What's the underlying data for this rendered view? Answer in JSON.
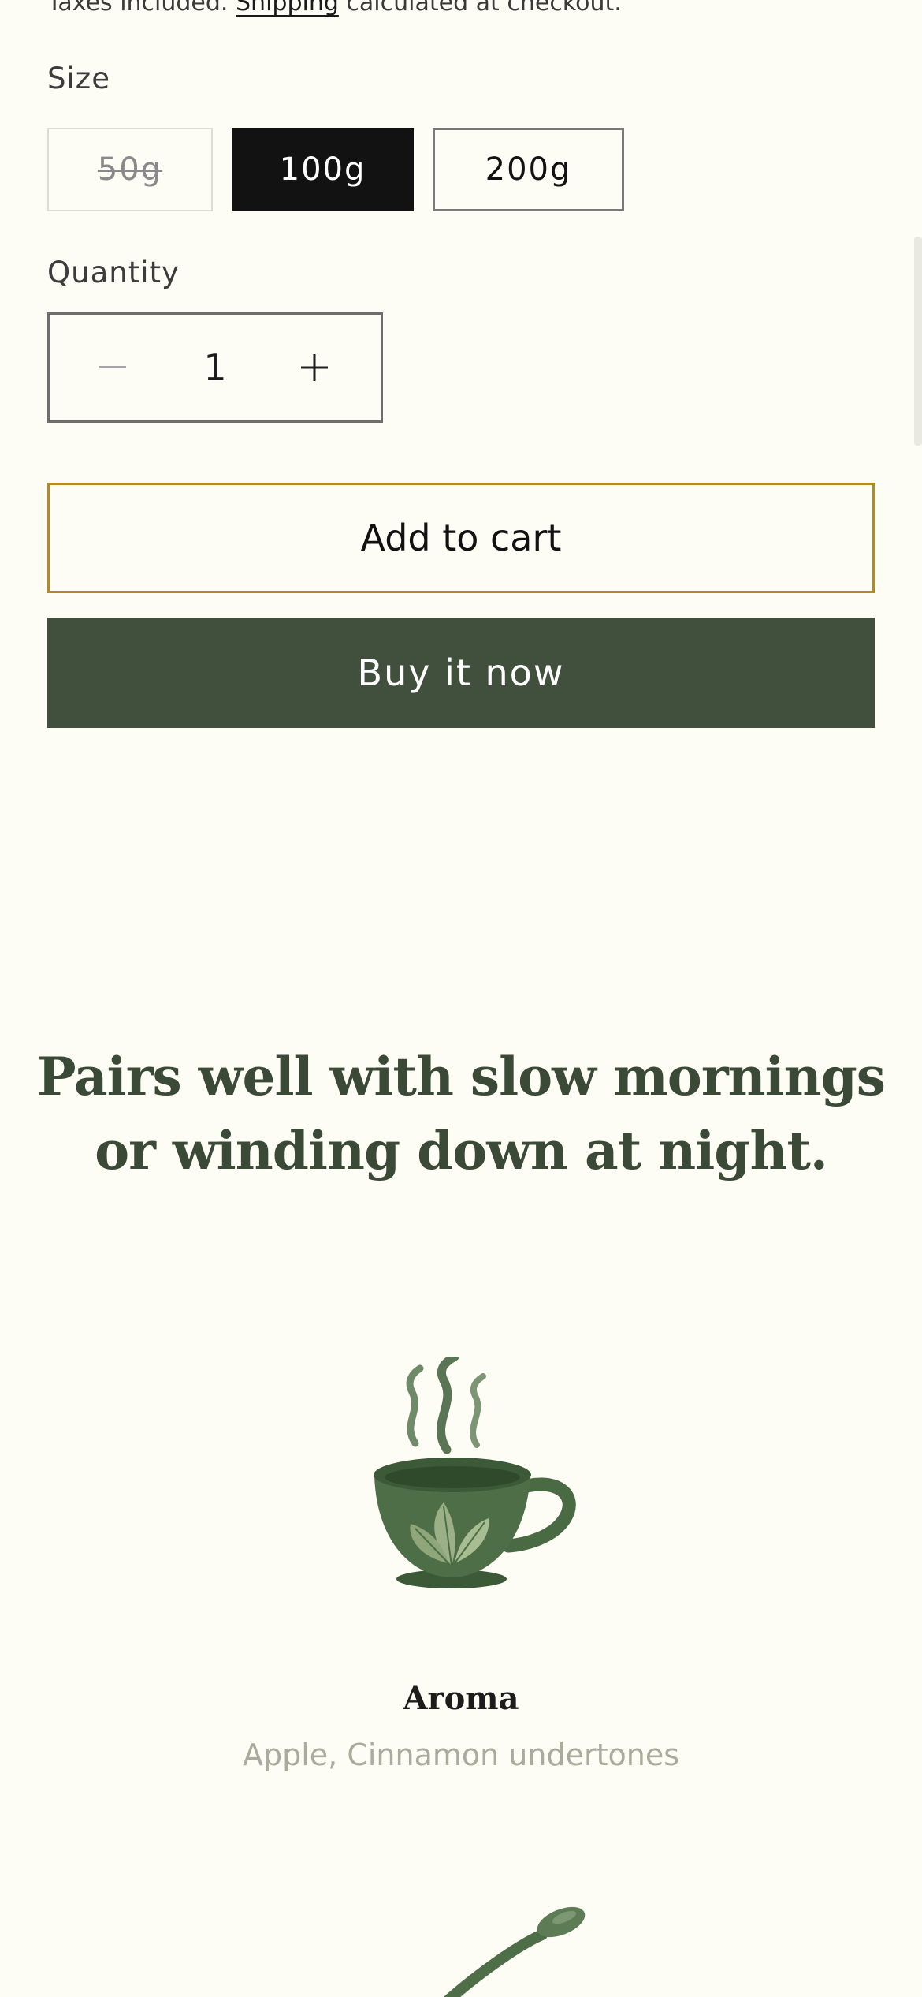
{
  "purchase": {
    "tax_note_prefix": "Taxes included. ",
    "tax_note_link": "Shipping",
    "tax_note_suffix": " calculated at checkout.",
    "size_label": "Size",
    "sizes": [
      {
        "label": "50g",
        "state": "unavailable"
      },
      {
        "label": "100g",
        "state": "selected"
      },
      {
        "label": "200g",
        "state": "available"
      }
    ],
    "quantity_label": "Quantity",
    "quantity_value": "1",
    "add_to_cart_label": "Add to cart",
    "buy_now_label": "Buy it now"
  },
  "feature_section": {
    "headline": "Pairs well with slow mornings or winding down at night.",
    "items": [
      {
        "icon": "teacup-icon",
        "title": "Aroma",
        "subtitle": "Apple, Cinnamon undertones"
      },
      {
        "icon": "spoon-icon"
      }
    ]
  },
  "colors": {
    "background": "#fdfcf5",
    "accent_green": "#40503c",
    "selected_size": "#121212",
    "cart_border": "#b38a25",
    "headline": "#3a4a36",
    "muted_text": "#a9ab9c"
  }
}
